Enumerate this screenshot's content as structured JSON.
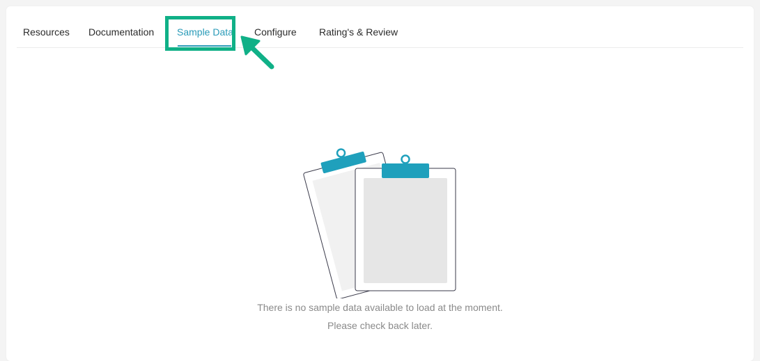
{
  "tabs": [
    {
      "label": "Resources"
    },
    {
      "label": "Documentation"
    },
    {
      "label": "Sample Data"
    },
    {
      "label": "Configure"
    },
    {
      "label": "Rating's & Review"
    }
  ],
  "active_tab": "Sample Data",
  "empty_state": {
    "line1": "There is no sample data available to load at the moment.",
    "line2": "Please check back later."
  },
  "colors": {
    "accent": "#2a9bb8",
    "highlight": "#10b087",
    "clip": "#1fa0bc"
  },
  "icons": {
    "illustration": "clipboard-icon",
    "annotation": "arrow-icon"
  }
}
